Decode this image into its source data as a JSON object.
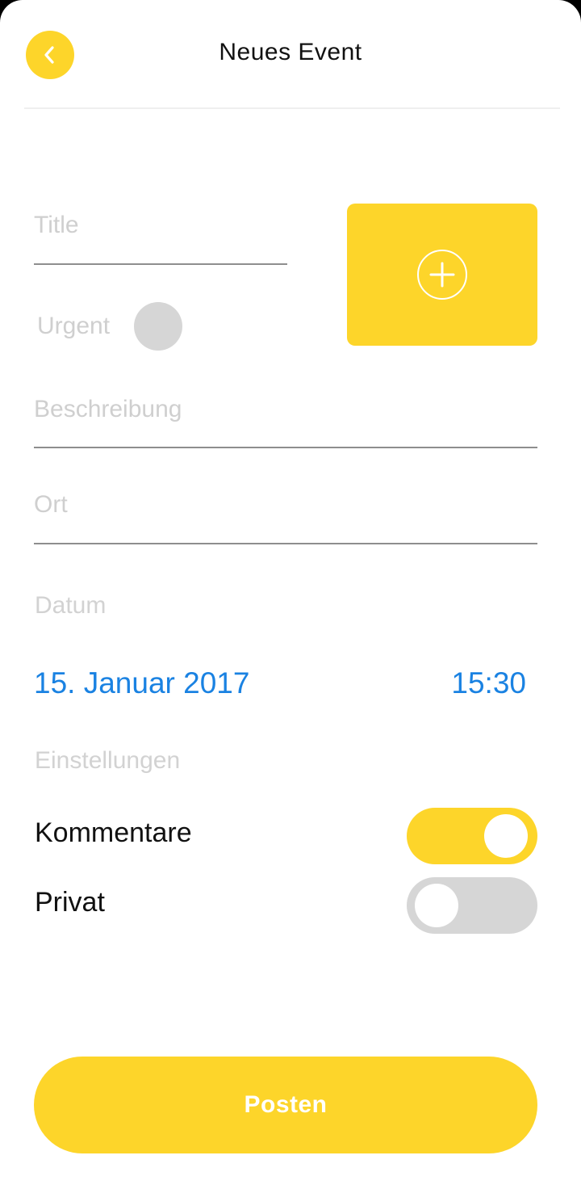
{
  "header": {
    "title": "Neues Event",
    "back_icon": "chevron-left-icon"
  },
  "form": {
    "title_placeholder": "Title",
    "title_value": "",
    "urgent_label": "Urgent",
    "urgent_checked": false,
    "image_add_icon": "plus-circle-icon",
    "description_placeholder": "Beschreibung",
    "description_value": "",
    "location_placeholder": "Ort",
    "location_value": ""
  },
  "date_section": {
    "label": "Datum",
    "date": "15. Januar 2017",
    "time": "15:30"
  },
  "settings": {
    "label": "Einstellungen",
    "items": [
      {
        "label": "Kommentare",
        "enabled": true
      },
      {
        "label": "Privat",
        "enabled": false
      }
    ]
  },
  "actions": {
    "post_label": "Posten"
  },
  "colors": {
    "accent": "#fdd52a",
    "link": "#1a82e2",
    "placeholder": "#cfcfcf",
    "toggle_off": "#d6d6d6",
    "underline": "#8e8e8e"
  }
}
